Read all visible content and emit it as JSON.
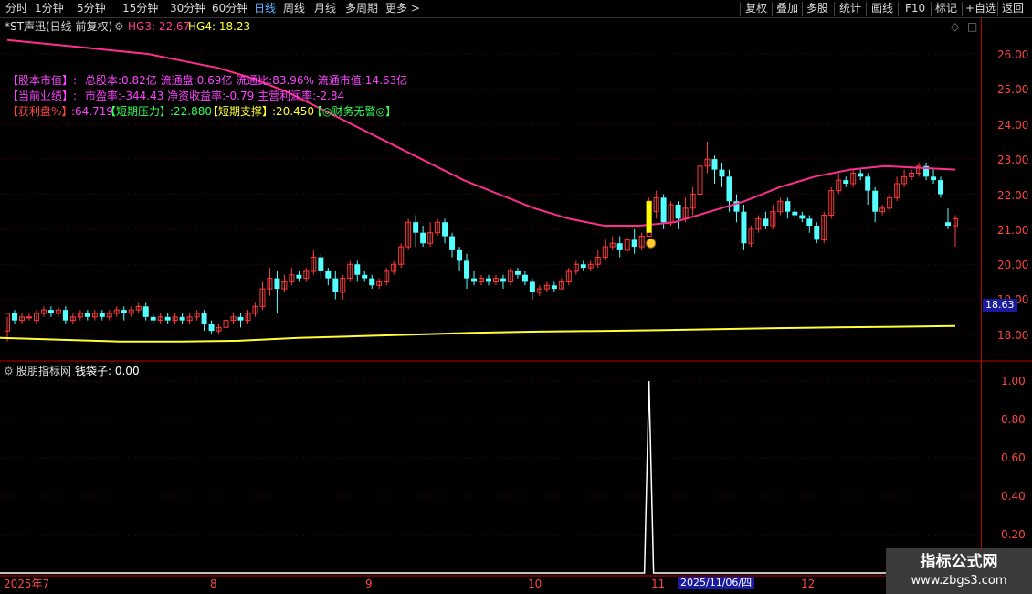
{
  "toolbar": {
    "periods": [
      "分时",
      "1分钟",
      "5分钟",
      "15分钟",
      "30分钟",
      "60分钟",
      "日线",
      "周线",
      "月线",
      "多周期",
      "更多 >"
    ],
    "active_period": "日线",
    "right_buttons": [
      "复权",
      "叠加",
      "多股",
      "统计",
      "画线",
      "F10",
      "标记",
      "+自选",
      "返回"
    ]
  },
  "main_chart": {
    "title": "*ST声迅(日线 前复权)",
    "hg3_label": "HG3: 22.67",
    "hg4_label": "HG4: 18.23",
    "info": {
      "l1_tag": "【股本市值】:",
      "l1_text": "总股本:0.82亿 流通盘:0.69亿 流通比:83.96% 流通市值:14.63亿",
      "l2_tag": "【当前业绩】:",
      "l2_text": "市盈率:-344.43 净资收益率:-0.79 主营利润率:-2.84",
      "l3_tag": "【获利盘%】",
      "l3_val": ":64.719",
      "l3_tag2": "【短期压力】",
      "l3_val2": ":22.880",
      "l3_tag3": "【短期支撑】",
      "l3_val3": ":20.450",
      "l3_tag4": "【◎财务无警◎】"
    },
    "y_ticks": [
      "26.00",
      "25.00",
      "24.00",
      "23.00",
      "22.00",
      "21.00",
      "20.00",
      "19.00",
      "18.00"
    ],
    "price_badge": "18.63",
    "colors": {
      "up": "#ff3b3b",
      "down": "#54ffff",
      "ma": "#ff2e8f",
      "base": "#ffff33",
      "badge": "#1a1aa0"
    }
  },
  "sub_chart": {
    "title": "股朋指标网",
    "value_label": "钱袋子: 0.00",
    "y_ticks": [
      "1.00",
      "0.80",
      "0.60",
      "0.40",
      "0.20"
    ]
  },
  "date_axis": {
    "labels": [
      "2025年7",
      "8",
      "9",
      "10",
      "11",
      "12"
    ],
    "cursor_date": "2025/11/06/四"
  },
  "watermark": {
    "line1": "指标公式网",
    "line2": "www.zbgs3.com"
  },
  "chart_data": {
    "type": "candlestick",
    "ylim": [
      17.5,
      26.8
    ],
    "candles": [
      [
        18.1,
        18.6,
        18.5,
        17.8
      ],
      [
        18.6,
        18.4,
        18.7,
        18.3
      ],
      [
        18.4,
        18.5,
        18.6,
        18.3
      ],
      [
        18.5,
        18.5,
        18.6,
        18.4
      ],
      [
        18.4,
        18.6,
        18.7,
        18.3
      ],
      [
        18.6,
        18.7,
        18.8,
        18.5
      ],
      [
        18.7,
        18.6,
        18.8,
        18.5
      ],
      [
        18.6,
        18.7,
        18.8,
        18.5
      ],
      [
        18.7,
        18.4,
        18.8,
        18.3
      ],
      [
        18.4,
        18.5,
        18.6,
        18.3
      ],
      [
        18.5,
        18.6,
        18.7,
        18.4
      ],
      [
        18.6,
        18.5,
        18.7,
        18.4
      ],
      [
        18.5,
        18.6,
        18.7,
        18.4
      ],
      [
        18.6,
        18.5,
        18.7,
        18.4
      ],
      [
        18.5,
        18.6,
        18.7,
        18.4
      ],
      [
        18.6,
        18.7,
        18.8,
        18.5
      ],
      [
        18.7,
        18.6,
        18.8,
        18.4
      ],
      [
        18.6,
        18.7,
        18.8,
        18.5
      ],
      [
        18.7,
        18.8,
        18.9,
        18.6
      ],
      [
        18.8,
        18.5,
        18.9,
        18.4
      ],
      [
        18.5,
        18.4,
        18.6,
        18.3
      ],
      [
        18.4,
        18.5,
        18.6,
        18.3
      ],
      [
        18.5,
        18.4,
        18.6,
        18.3
      ],
      [
        18.4,
        18.5,
        18.6,
        18.3
      ],
      [
        18.5,
        18.4,
        18.6,
        18.3
      ],
      [
        18.4,
        18.5,
        18.6,
        18.3
      ],
      [
        18.5,
        18.6,
        18.7,
        18.4
      ],
      [
        18.6,
        18.3,
        18.7,
        18.1
      ],
      [
        18.3,
        18.1,
        18.4,
        18.0
      ],
      [
        18.1,
        18.2,
        18.3,
        18.0
      ],
      [
        18.2,
        18.4,
        18.5,
        18.1
      ],
      [
        18.4,
        18.5,
        18.6,
        18.3
      ],
      [
        18.5,
        18.4,
        18.6,
        18.2
      ],
      [
        18.4,
        18.6,
        18.7,
        18.3
      ],
      [
        18.6,
        18.8,
        18.9,
        18.5
      ],
      [
        18.8,
        19.3,
        19.5,
        18.7
      ],
      [
        19.3,
        19.6,
        19.9,
        19.1
      ],
      [
        19.6,
        19.3,
        19.8,
        18.6
      ],
      [
        19.3,
        19.5,
        19.7,
        19.2
      ],
      [
        19.5,
        19.7,
        19.9,
        19.4
      ],
      [
        19.7,
        19.6,
        19.8,
        19.5
      ],
      [
        19.6,
        19.8,
        19.9,
        19.5
      ],
      [
        19.8,
        20.2,
        20.4,
        19.7
      ],
      [
        20.2,
        19.8,
        20.3,
        19.6
      ],
      [
        19.8,
        19.6,
        19.9,
        19.4
      ],
      [
        19.6,
        19.2,
        19.8,
        19.0
      ],
      [
        19.2,
        19.6,
        19.7,
        19.0
      ],
      [
        19.6,
        20.0,
        20.1,
        19.5
      ],
      [
        20.0,
        19.7,
        20.1,
        19.5
      ],
      [
        19.7,
        19.6,
        19.8,
        19.5
      ],
      [
        19.6,
        19.4,
        19.7,
        19.3
      ],
      [
        19.4,
        19.5,
        19.6,
        19.3
      ],
      [
        19.5,
        19.8,
        19.9,
        19.4
      ],
      [
        19.8,
        20.0,
        20.1,
        19.7
      ],
      [
        20.0,
        20.5,
        20.6,
        19.9
      ],
      [
        20.5,
        21.2,
        21.3,
        20.4
      ],
      [
        21.2,
        20.9,
        21.4,
        20.5
      ],
      [
        20.9,
        20.6,
        21.1,
        20.5
      ],
      [
        20.6,
        20.9,
        21.2,
        20.5
      ],
      [
        20.9,
        21.2,
        21.3,
        20.8
      ],
      [
        21.2,
        20.8,
        21.3,
        20.6
      ],
      [
        20.8,
        20.4,
        20.9,
        20.2
      ],
      [
        20.4,
        20.1,
        20.5,
        19.8
      ],
      [
        20.1,
        19.6,
        20.3,
        19.3
      ],
      [
        19.6,
        19.5,
        19.8,
        19.4
      ],
      [
        19.5,
        19.6,
        19.7,
        19.4
      ],
      [
        19.6,
        19.5,
        19.7,
        19.4
      ],
      [
        19.5,
        19.6,
        19.7,
        19.4
      ],
      [
        19.6,
        19.5,
        19.7,
        19.3
      ],
      [
        19.5,
        19.8,
        19.9,
        19.4
      ],
      [
        19.8,
        19.7,
        19.9,
        19.6
      ],
      [
        19.7,
        19.5,
        19.8,
        19.4
      ],
      [
        19.5,
        19.2,
        19.6,
        19.0
      ],
      [
        19.2,
        19.3,
        19.4,
        19.1
      ],
      [
        19.3,
        19.4,
        19.5,
        19.2
      ],
      [
        19.4,
        19.3,
        19.5,
        19.2
      ],
      [
        19.3,
        19.5,
        19.6,
        19.3
      ],
      [
        19.5,
        19.8,
        19.9,
        19.4
      ],
      [
        19.8,
        20.0,
        20.1,
        19.7
      ],
      [
        20.0,
        19.9,
        20.1,
        19.8
      ],
      [
        19.9,
        20.0,
        20.1,
        19.8
      ],
      [
        20.0,
        20.2,
        20.4,
        19.9
      ],
      [
        20.2,
        20.5,
        20.7,
        20.1
      ],
      [
        20.5,
        20.6,
        20.8,
        20.4
      ],
      [
        20.6,
        20.4,
        20.8,
        20.2
      ],
      [
        20.4,
        20.7,
        20.8,
        20.3
      ],
      [
        20.7,
        20.5,
        21.0,
        20.3
      ],
      [
        20.5,
        20.8,
        20.9,
        20.4
      ],
      [
        20.8,
        21.8,
        21.9,
        20.9
      ],
      [
        21.5,
        21.9,
        22.1,
        21.3
      ],
      [
        21.9,
        21.2,
        22.0,
        21.0
      ],
      [
        21.2,
        21.7,
        21.8,
        21.1
      ],
      [
        21.7,
        21.3,
        21.8,
        21.0
      ],
      [
        21.3,
        21.6,
        21.9,
        21.2
      ],
      [
        21.6,
        22.0,
        22.2,
        21.4
      ],
      [
        22.0,
        22.8,
        23.0,
        21.8
      ],
      [
        22.8,
        23.0,
        23.5,
        22.6
      ],
      [
        23.0,
        22.7,
        23.1,
        22.3
      ],
      [
        22.7,
        22.5,
        22.9,
        22.2
      ],
      [
        22.5,
        21.8,
        22.7,
        21.5
      ],
      [
        21.8,
        21.5,
        22.0,
        21.2
      ],
      [
        21.5,
        20.6,
        21.7,
        20.4
      ],
      [
        20.6,
        21.0,
        21.1,
        20.5
      ],
      [
        21.0,
        21.3,
        21.4,
        20.9
      ],
      [
        21.3,
        21.1,
        21.5,
        21.0
      ],
      [
        21.1,
        21.5,
        21.7,
        21.0
      ],
      [
        21.5,
        21.8,
        21.9,
        21.4
      ],
      [
        21.8,
        21.5,
        21.9,
        21.3
      ],
      [
        21.5,
        21.4,
        21.6,
        21.3
      ],
      [
        21.4,
        21.3,
        21.5,
        21.2
      ],
      [
        21.3,
        21.1,
        21.4,
        20.9
      ],
      [
        21.1,
        20.7,
        21.2,
        20.6
      ],
      [
        20.7,
        21.4,
        21.5,
        20.6
      ],
      [
        21.4,
        22.1,
        22.2,
        21.3
      ],
      [
        22.1,
        22.4,
        22.6,
        22.0
      ],
      [
        22.4,
        22.3,
        22.5,
        22.2
      ],
      [
        22.3,
        22.6,
        22.7,
        22.2
      ],
      [
        22.6,
        22.5,
        22.7,
        22.4
      ],
      [
        22.5,
        22.1,
        22.6,
        21.7
      ],
      [
        22.1,
        21.5,
        22.2,
        21.2
      ],
      [
        21.5,
        21.6,
        21.7,
        21.4
      ],
      [
        21.6,
        21.9,
        22.0,
        21.5
      ],
      [
        21.9,
        22.3,
        22.5,
        21.8
      ],
      [
        22.3,
        22.5,
        22.7,
        22.2
      ],
      [
        22.5,
        22.6,
        22.7,
        22.4
      ],
      [
        22.6,
        22.8,
        22.9,
        22.5
      ],
      [
        22.8,
        22.5,
        22.9,
        22.4
      ],
      [
        22.5,
        22.4,
        22.7,
        22.3
      ],
      [
        22.4,
        22.0,
        22.5,
        21.9
      ],
      [
        21.2,
        21.1,
        21.6,
        21.0
      ],
      [
        21.1,
        21.3,
        21.4,
        20.5
      ]
    ],
    "ma_line": [
      26.4,
      26.3,
      26.2,
      26.1,
      26.0,
      25.8,
      25.6,
      25.3,
      24.9,
      24.4,
      23.9,
      23.4,
      22.9,
      22.4,
      22.0,
      21.6,
      21.3,
      21.1,
      21.1,
      21.2,
      21.5,
      21.8,
      22.2,
      22.5,
      22.7,
      22.8,
      22.75,
      22.7
    ],
    "base_line": [
      17.9,
      17.85,
      17.8,
      17.8,
      17.82,
      17.9,
      17.95,
      18.0,
      18.05,
      18.08,
      18.1,
      18.12,
      18.15,
      18.18,
      18.2,
      18.22,
      18.24
    ],
    "signal_series": [
      {
        "name": "钱袋子",
        "spike_index": 88,
        "spike_value": 1.0
      }
    ]
  }
}
